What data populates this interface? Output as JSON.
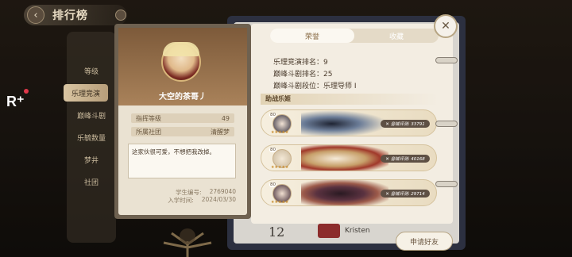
{
  "header": {
    "title": "排行榜"
  },
  "side_menu": {
    "items": [
      "等级",
      "乐理竞演",
      "巅峰斗剧",
      "乐毓数量",
      "梦井",
      "社团"
    ]
  },
  "ranking_list": {
    "rank": "12",
    "name": "Kristen"
  },
  "profile": {
    "name": "大空的茶哥丿",
    "level_label": "指挥等级",
    "level_value": "49",
    "club_label": "所属社团",
    "club_value": "清醒梦",
    "bio": "这家伙很可爱，不想把我改掉。",
    "student_id_label": "学生编号:",
    "student_id": "2769040",
    "join_label": "入学时间:",
    "join_date": "2024/03/30"
  },
  "detail": {
    "tabs": [
      "荣誉",
      "收藏"
    ],
    "active_tab": "荣誉",
    "stats": [
      "乐理竞演排名：9",
      "巅峰斗剧排名：25",
      "巅峰斗剧段位：乐理导师 Ⅰ"
    ],
    "helper_title": "助战乐姬",
    "helpers": [
      {
        "level": "80",
        "power": "✕ 音械评测: 33791",
        "stars": "★★★★★"
      },
      {
        "level": "80",
        "power": "✕ 音械评测: 40168",
        "stars": "★★★★★"
      },
      {
        "level": "80",
        "power": "✕ 音械评测: 29714",
        "stars": "★★★★★"
      }
    ]
  },
  "buttons": {
    "close": "✕",
    "add_friend": "申请好友",
    "back": "‹"
  },
  "colors": {
    "accent": "#b7a583",
    "panel": "#f3ede2",
    "tab_active": "#fbf8f1"
  }
}
